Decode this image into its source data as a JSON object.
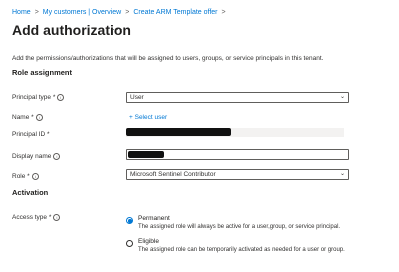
{
  "breadcrumb": {
    "items": [
      "Home",
      "My customers | Overview",
      "Create ARM Template offer"
    ],
    "separator": ">"
  },
  "header": {
    "title": "Add authorization",
    "more_icon": "ellipsis-icon",
    "more_label": "···"
  },
  "description": "Add the permissions/authorizations that will be assigned to users, groups, or service principals in this tenant.",
  "role_assignment": {
    "section_title": "Role assignment",
    "principal_type": {
      "label": "Principal type *",
      "value": "User"
    },
    "name": {
      "label": "Name *",
      "link_label": "Select user",
      "link_icon": "plus-icon"
    },
    "principal_id": {
      "label": "Principal ID *"
    },
    "display_name": {
      "label": "Display name"
    },
    "role": {
      "label": "Role *",
      "value": "Microsoft Sentinel Contributor"
    }
  },
  "activation": {
    "section_title": "Activation",
    "access_type": {
      "label": "Access type *",
      "options": [
        {
          "title": "Permanent",
          "description": "The assigned role will always be active for a user,group, or service principal.",
          "selected": true
        },
        {
          "title": "Eligible",
          "description": "The assigned role can be temporarily activated as needed for a user or group.",
          "selected": false
        }
      ]
    }
  },
  "colors": {
    "accent": "#0078d4",
    "text": "#323130",
    "readonly_bg": "#f3f2f1"
  }
}
